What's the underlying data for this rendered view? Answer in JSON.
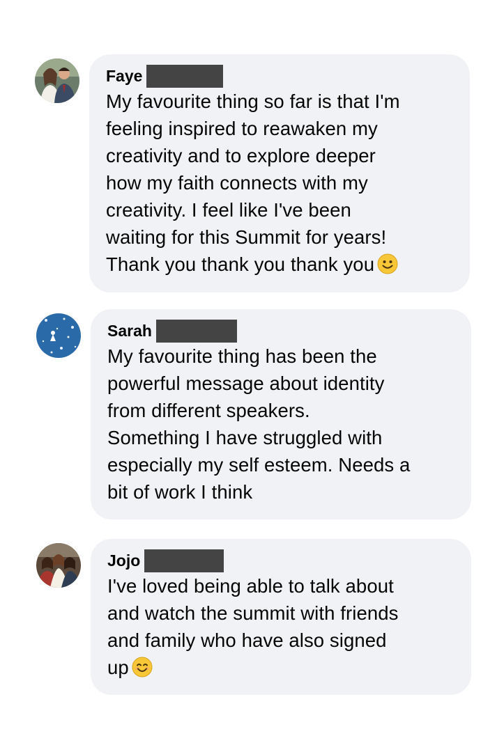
{
  "comments": [
    {
      "author": "Faye",
      "text": "My favourite thing so far is that I'm\nfeeling inspired to reawaken my\ncreativity and to explore deeper\nhow my faith connects with my\ncreativity. I feel like I've been\nwaiting for this Summit for years!\nThank you thank you thank you",
      "emoji": "slightly-smiling-face"
    },
    {
      "author": "Sarah",
      "text": "My favourite thing has been the\npowerful message about identity\nfrom different speakers.\nSomething I have struggled with\nespecially my self esteem. Needs a\nbit of work I think",
      "emoji": ""
    },
    {
      "author": "Jojo",
      "text": "I've loved being able to talk about\nand watch the summit with friends\nand family who have also signed\nup",
      "emoji": "smiling-face-with-smiling-eyes"
    }
  ],
  "colors": {
    "bubble": "#f0f2f5",
    "text": "#050505",
    "redaction": "#444444"
  }
}
